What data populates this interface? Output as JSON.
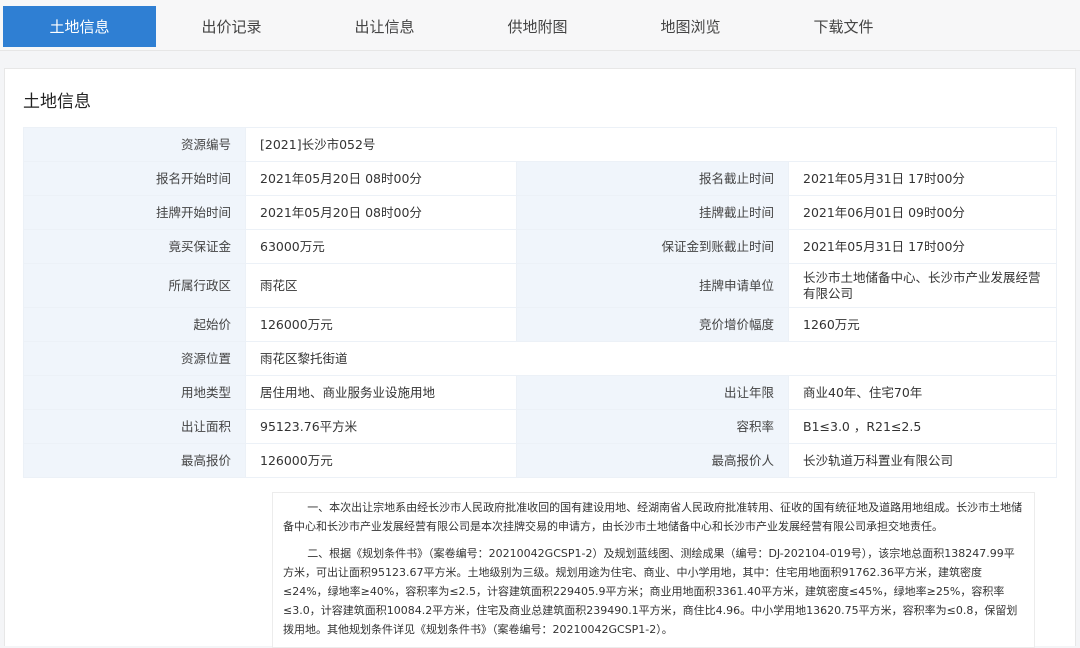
{
  "tabs": [
    {
      "label": "土地信息",
      "active": true
    },
    {
      "label": "出价记录"
    },
    {
      "label": "出让信息"
    },
    {
      "label": "供地附图"
    },
    {
      "label": "地图浏览"
    },
    {
      "label": "下载文件"
    }
  ],
  "panel": {
    "title": "土地信息"
  },
  "rows": [
    {
      "l1": "资源编号",
      "v1": "[2021]长沙市052号",
      "l2": "",
      "v2": ""
    },
    {
      "l1": "报名开始时间",
      "v1": "2021年05月20日 08时00分",
      "l2": "报名截止时间",
      "v2": "2021年05月31日 17时00分"
    },
    {
      "l1": "挂牌开始时间",
      "v1": "2021年05月20日 08时00分",
      "l2": "挂牌截止时间",
      "v2": "2021年06月01日 09时00分"
    },
    {
      "l1": "竟买保证金",
      "v1": "63000万元",
      "l2": "保证金到账截止时间",
      "v2": "2021年05月31日 17时00分"
    },
    {
      "l1": "所属行政区",
      "v1": "雨花区",
      "l2": "挂牌申请单位",
      "v2": "长沙市土地储备中心、长沙市产业发展经营有限公司"
    },
    {
      "l1": "起始价",
      "v1": "126000万元",
      "l2": "竞价增价幅度",
      "v2": "1260万元"
    },
    {
      "l1": "资源位置",
      "v1": "雨花区黎托街道",
      "l2": "",
      "v2": ""
    },
    {
      "l1": "用地类型",
      "v1": "居住用地、商业服务业设施用地",
      "l2": "出让年限",
      "v2": "商业40年、住宅70年"
    },
    {
      "l1": "出让面积",
      "v1": "95123.76平方米",
      "l2": "容积率",
      "v2": "B1≤3.0 ，R21≤2.5"
    },
    {
      "l1": "最高报价",
      "v1": "126000万元",
      "l2": "最高报价人",
      "v2": "长沙轨道万科置业有限公司"
    }
  ],
  "notes": {
    "p1": "一、本次出让宗地系由经长沙市人民政府批准收回的国有建设用地、经湖南省人民政府批准转用、征收的国有统征地及道路用地组成。长沙市土地储备中心和长沙市产业发展经营有限公司是本次挂牌交易的申请方，由长沙市土地储备中心和长沙市产业发展经营有限公司承担交地责任。",
    "p2": "二、根据《规划条件书》（案卷编号：20210042GCSP1-2）及规划蓝线图、测绘成果（编号：DJ-202104-019号），该宗地总面积138247.99平方米，可出让面积95123.67平方米。土地级别为三级。规划用途为住宅、商业、中小学用地，其中：住宅用地面积91762.36平方米，建筑密度≤24%，绿地率≥40%，容积率为≤2.5，计容建筑面积229405.9平方米；商业用地面积3361.40平方米，建筑密度≤45%，绿地率≥25%，容积率≤3.0，计容建筑面积10084.2平方米，住宅及商业总建筑面积239490.1平方米，商住比4.96。中小学用地13620.75平方米，容积率为≤0.8，保留划拨用地。其他规划条件详见《规划条件书》（案卷编号：20210042GCSP1-2）。"
  }
}
